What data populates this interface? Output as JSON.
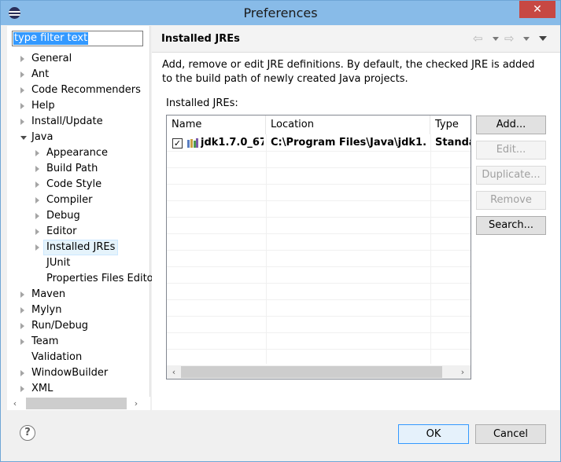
{
  "window": {
    "title": "Preferences",
    "close_glyph": "✕"
  },
  "filter": {
    "placeholder": "type filter text",
    "value": "type filter text"
  },
  "tree": {
    "items": [
      {
        "label": "General",
        "has_children": true,
        "expanded": false
      },
      {
        "label": "Ant",
        "has_children": true,
        "expanded": false
      },
      {
        "label": "Code Recommenders",
        "has_children": true,
        "expanded": false
      },
      {
        "label": "Help",
        "has_children": true,
        "expanded": false
      },
      {
        "label": "Install/Update",
        "has_children": true,
        "expanded": false
      },
      {
        "label": "Java",
        "has_children": true,
        "expanded": true
      },
      {
        "label": "Appearance",
        "has_children": true,
        "expanded": false
      },
      {
        "label": "Build Path",
        "has_children": true,
        "expanded": false
      },
      {
        "label": "Code Style",
        "has_children": true,
        "expanded": false
      },
      {
        "label": "Compiler",
        "has_children": true,
        "expanded": false
      },
      {
        "label": "Debug",
        "has_children": true,
        "expanded": false
      },
      {
        "label": "Editor",
        "has_children": true,
        "expanded": false
      },
      {
        "label": "Installed JREs",
        "has_children": true,
        "expanded": false,
        "selected": true
      },
      {
        "label": "JUnit",
        "has_children": false,
        "expanded": false
      },
      {
        "label": "Properties Files Edito",
        "has_children": false,
        "expanded": false
      },
      {
        "label": "Maven",
        "has_children": true,
        "expanded": false
      },
      {
        "label": "Mylyn",
        "has_children": true,
        "expanded": false
      },
      {
        "label": "Run/Debug",
        "has_children": true,
        "expanded": false
      },
      {
        "label": "Team",
        "has_children": true,
        "expanded": false
      },
      {
        "label": "Validation",
        "has_children": false,
        "expanded": false
      },
      {
        "label": "WindowBuilder",
        "has_children": true,
        "expanded": false
      },
      {
        "label": "XML",
        "has_children": true,
        "expanded": false
      }
    ],
    "scroll_left": "‹",
    "scroll_right": "›"
  },
  "page": {
    "title": "Installed JREs",
    "nav_back_icon": "⇦",
    "nav_forward_icon": "⇨",
    "description": "Add, remove or edit JRE definitions. By default, the checked JRE is added to the build path of newly created Java projects.",
    "list_label": "Installed JREs:"
  },
  "table": {
    "columns": [
      "Name",
      "Location",
      "Type"
    ],
    "rows": [
      {
        "checked": true,
        "name": "jdk1.7.0_67 ...",
        "location": "C:\\Program Files\\Java\\jdk1....",
        "type": "Standar"
      }
    ],
    "scroll_left": "‹",
    "scroll_right": "›"
  },
  "buttons": {
    "add": "Add...",
    "edit": "Edit...",
    "duplicate": "Duplicate...",
    "remove": "Remove",
    "search": "Search...",
    "ok": "OK",
    "cancel": "Cancel",
    "help": "?"
  },
  "colors": {
    "titlebar": "#88bbe8",
    "close": "#c74843",
    "selection": "#3399ff"
  }
}
